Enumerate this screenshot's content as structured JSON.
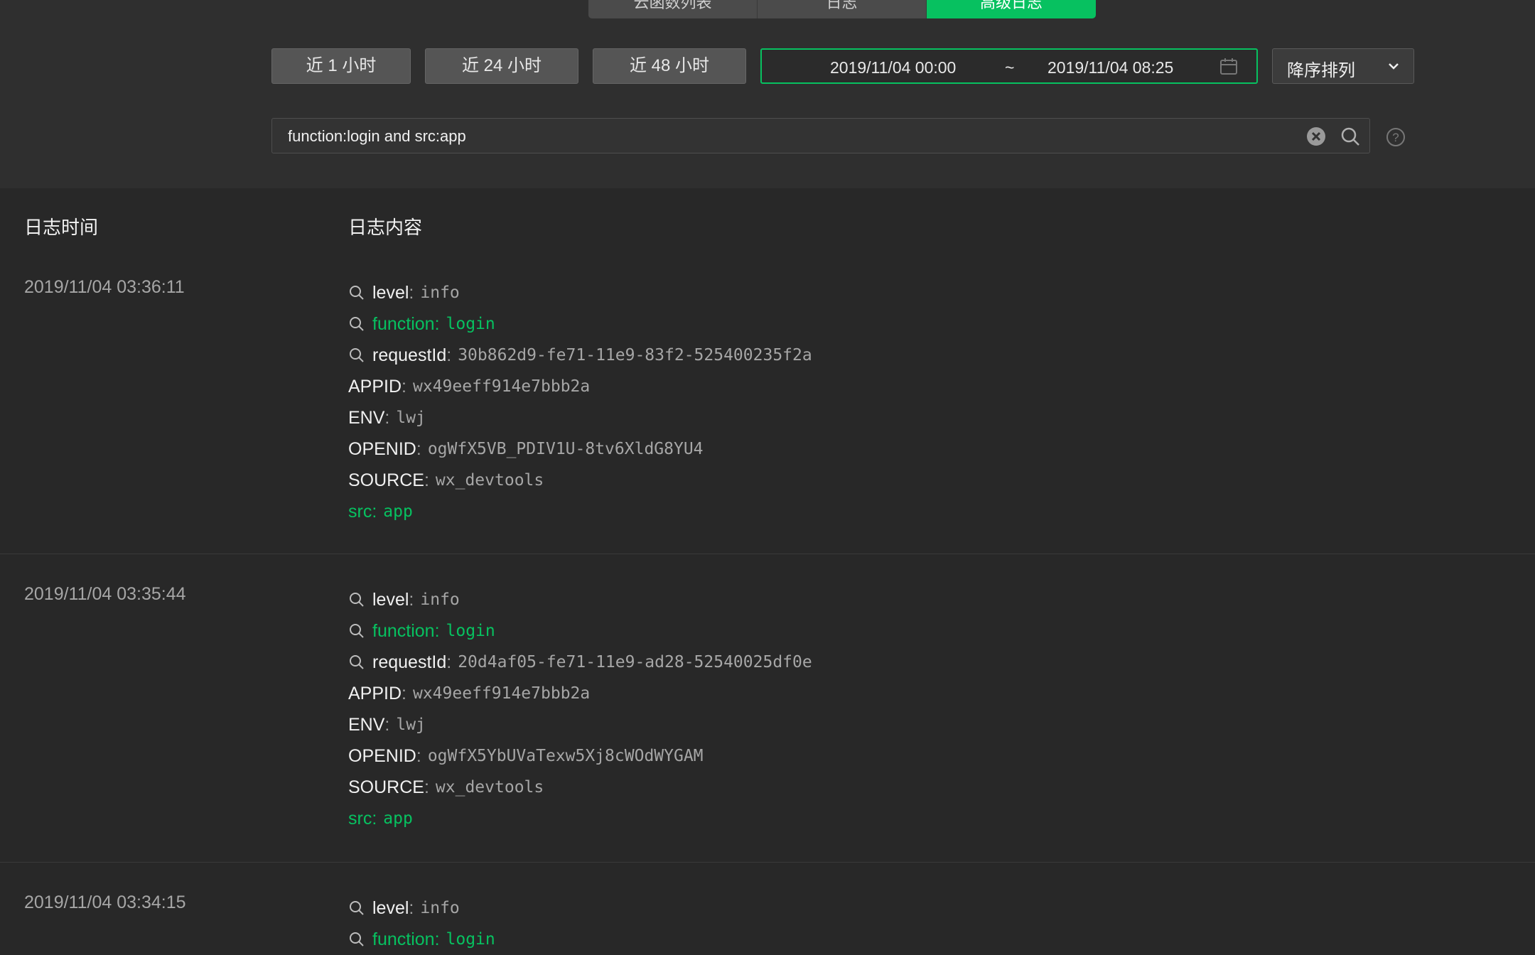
{
  "tabs": [
    {
      "label": "云函数列表"
    },
    {
      "label": "日志"
    },
    {
      "label": "高级日志"
    }
  ],
  "range_buttons": [
    "近 1 小时",
    "近 24 小时",
    "近 48 小时"
  ],
  "date_range": {
    "start": "2019/11/04 00:00",
    "separator": "~",
    "end": "2019/11/04 08:25"
  },
  "sort": {
    "selected": "降序排列"
  },
  "search": {
    "value": "function:login and src:app"
  },
  "table": {
    "col_time": "日志时间",
    "col_content": "日志内容"
  },
  "entries": [
    {
      "time": "2019/11/04 03:36:11",
      "fields": [
        {
          "key": "level",
          "value": "info",
          "searchable": true,
          "highlight": false
        },
        {
          "key": "function",
          "value": "login",
          "searchable": true,
          "highlight": true
        },
        {
          "key": "requestId",
          "value": "30b862d9-fe71-11e9-83f2-525400235f2a",
          "searchable": true,
          "highlight": false
        },
        {
          "key": "APPID",
          "value": "wx49eeff914e7bbb2a",
          "searchable": false,
          "highlight": false
        },
        {
          "key": "ENV",
          "value": "lwj",
          "searchable": false,
          "highlight": false
        },
        {
          "key": "OPENID",
          "value": "ogWfX5VB_PDIV1U-8tv6XldG8YU4",
          "searchable": false,
          "highlight": false
        },
        {
          "key": "SOURCE",
          "value": "wx_devtools",
          "searchable": false,
          "highlight": false
        },
        {
          "key": "src",
          "value": "app",
          "searchable": false,
          "highlight": true
        }
      ]
    },
    {
      "time": "2019/11/04 03:35:44",
      "fields": [
        {
          "key": "level",
          "value": "info",
          "searchable": true,
          "highlight": false
        },
        {
          "key": "function",
          "value": "login",
          "searchable": true,
          "highlight": true
        },
        {
          "key": "requestId",
          "value": "20d4af05-fe71-11e9-ad28-52540025df0e",
          "searchable": true,
          "highlight": false
        },
        {
          "key": "APPID",
          "value": "wx49eeff914e7bbb2a",
          "searchable": false,
          "highlight": false
        },
        {
          "key": "ENV",
          "value": "lwj",
          "searchable": false,
          "highlight": false
        },
        {
          "key": "OPENID",
          "value": "ogWfX5YbUVaTexw5Xj8cWOdWYGAM",
          "searchable": false,
          "highlight": false
        },
        {
          "key": "SOURCE",
          "value": "wx_devtools",
          "searchable": false,
          "highlight": false
        },
        {
          "key": "src",
          "value": "app",
          "searchable": false,
          "highlight": true
        }
      ]
    },
    {
      "time": "2019/11/04 03:34:15",
      "fields": [
        {
          "key": "level",
          "value": "info",
          "searchable": true,
          "highlight": false
        },
        {
          "key": "function",
          "value": "login",
          "searchable": true,
          "highlight": true
        }
      ]
    }
  ],
  "colors": {
    "accent": "#07c160",
    "background": "#282828",
    "toolbar": "#2f2f2f"
  },
  "icons": {
    "calendar": "calendar-icon",
    "chevron": "chevron-down-icon",
    "clear": "clear-icon",
    "search": "search-icon",
    "help": "help-icon",
    "field_search": "magnifier-icon"
  }
}
